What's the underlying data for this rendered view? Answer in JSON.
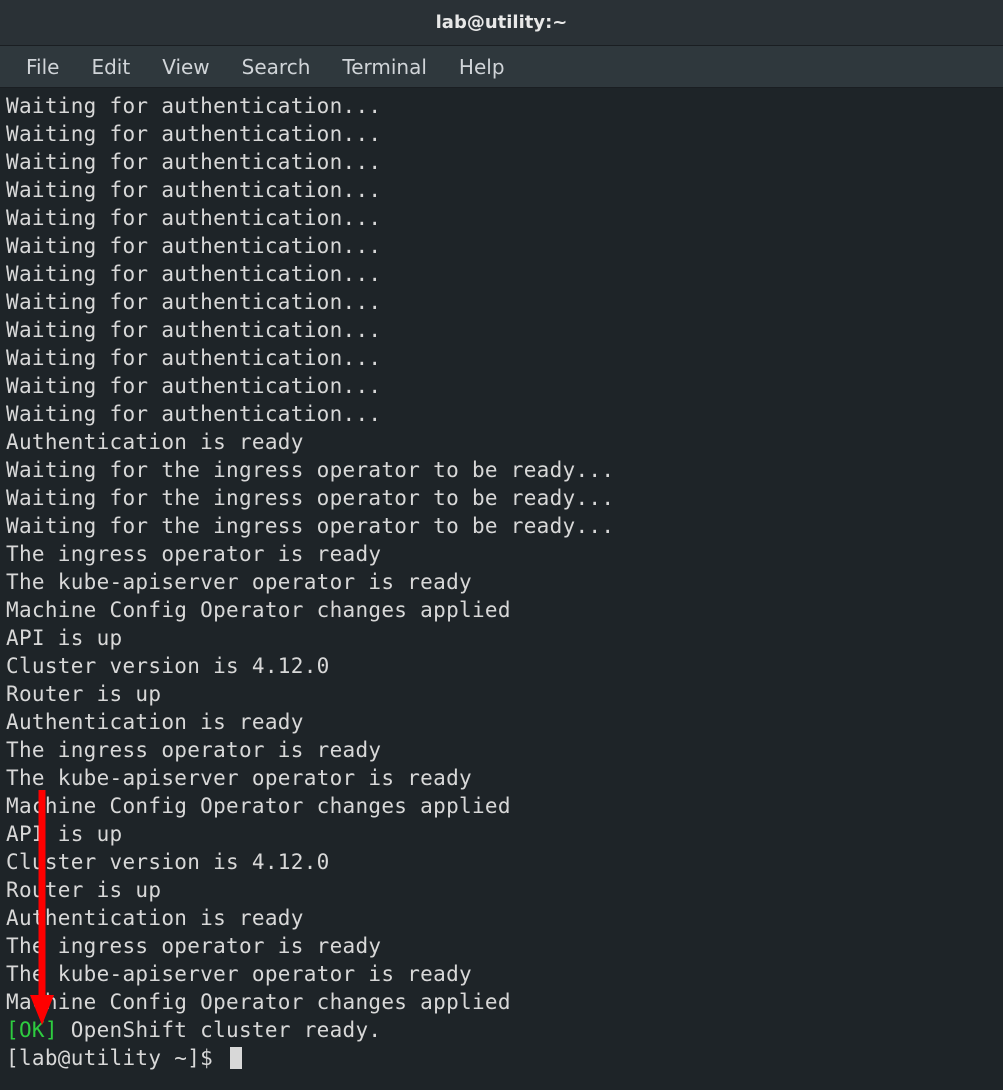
{
  "window": {
    "title": "lab@utility:~"
  },
  "menubar": {
    "items": [
      "File",
      "Edit",
      "View",
      "Search",
      "Terminal",
      "Help"
    ]
  },
  "terminal": {
    "lines": [
      "Waiting for authentication...",
      "Waiting for authentication...",
      "Waiting for authentication...",
      "Waiting for authentication...",
      "Waiting for authentication...",
      "Waiting for authentication...",
      "Waiting for authentication...",
      "Waiting for authentication...",
      "Waiting for authentication...",
      "Waiting for authentication...",
      "Waiting for authentication...",
      "Waiting for authentication...",
      "Authentication is ready",
      "Waiting for the ingress operator to be ready...",
      "Waiting for the ingress operator to be ready...",
      "Waiting for the ingress operator to be ready...",
      "The ingress operator is ready",
      "The kube-apiserver operator is ready",
      "Machine Config Operator changes applied",
      "API is up",
      "Cluster version is 4.12.0",
      "Router is up",
      "Authentication is ready",
      "The ingress operator is ready",
      "The kube-apiserver operator is ready",
      "Machine Config Operator changes applied",
      "API is up",
      "Cluster version is 4.12.0",
      "Router is up",
      "Authentication is ready",
      "The ingress operator is ready",
      "The kube-apiserver operator is ready",
      "Machine Config Operator changes applied"
    ],
    "ok_prefix": "[OK]",
    "ok_message": " OpenShift cluster ready.",
    "prompt": "[lab@utility ~]$ "
  },
  "annotation": {
    "arrow_color": "#ff0000"
  }
}
